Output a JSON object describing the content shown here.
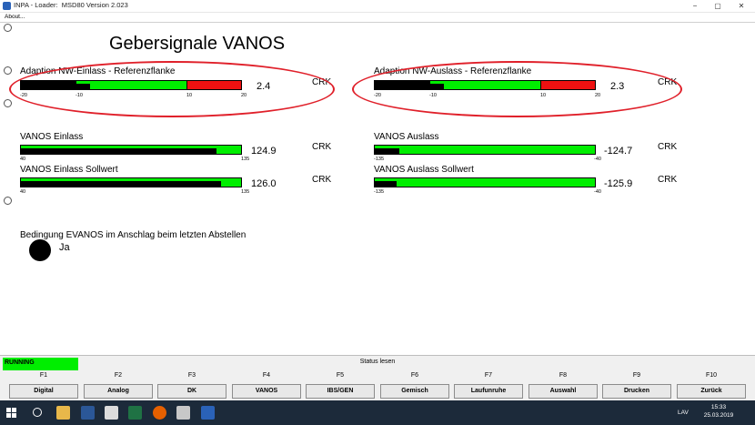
{
  "window": {
    "title": "INPA - Loader:  MSD80 Version 2.023",
    "menu_about": "About...",
    "minimize": "−",
    "maximize": "▢",
    "close": "✕"
  },
  "main": {
    "heading": "Gebersignale VANOS"
  },
  "adaption_einlass": {
    "label": "Adaption NW-Einlass - Referenzflanke",
    "value": "2.4",
    "unit": "CRK",
    "ticks": [
      "-20",
      "-10",
      "10",
      "20"
    ],
    "level": 2.4
  },
  "adaption_auslass": {
    "label": "Adaption NW-Auslass - Referenzflanke",
    "value": "2.3",
    "unit": "CRK",
    "ticks": [
      "-20",
      "-10",
      "10",
      "20"
    ],
    "level": 2.3
  },
  "vanos_einlass": {
    "label": "VANOS Einlass",
    "value": "124.9",
    "unit": "CRK",
    "tick_min": "40",
    "tick_max": "135",
    "level_fraction": 0.89
  },
  "vanos_einlass_soll": {
    "label": "VANOS Einlass Sollwert",
    "value": "126.0",
    "unit": "CRK",
    "tick_min": "40",
    "tick_max": "135",
    "level_fraction": 0.91
  },
  "vanos_auslass": {
    "label": "VANOS Auslass",
    "value": "-124.7",
    "unit": "CRK",
    "tick_min": "-135",
    "tick_max": "-40",
    "level_fraction": 0.11
  },
  "vanos_auslass_soll": {
    "label": "VANOS Auslass Sollwert",
    "value": "-125.9",
    "unit": "CRK",
    "tick_min": "-135",
    "tick_max": "-40",
    "level_fraction": 0.1
  },
  "bedingung": {
    "label": "Bedingung EVANOS im Anschlag beim letzten Abstellen",
    "value": "Ja"
  },
  "status": {
    "running": "RUNNING",
    "text": "Status lesen"
  },
  "fkeys": [
    {
      "key": "F1",
      "label": "Digital"
    },
    {
      "key": "F2",
      "label": "Analog"
    },
    {
      "key": "F3",
      "label": "DK"
    },
    {
      "key": "F4",
      "label": "VANOS"
    },
    {
      "key": "F5",
      "label": "IBS/GEN"
    },
    {
      "key": "F6",
      "label": "Gemisch"
    },
    {
      "key": "F7",
      "label": "Laufunruhe"
    },
    {
      "key": "F8",
      "label": "Auswahl"
    },
    {
      "key": "F9",
      "label": "Drucken"
    },
    {
      "key": "F10",
      "label": "Zurück"
    }
  ],
  "taskbar": {
    "lang": "LAV",
    "time": "15:33",
    "date": "25.03.2019"
  },
  "colors": {
    "bar_green": "#00ee00",
    "bar_red": "#ee1111",
    "ellipse_red": "#e0202a",
    "running_green": "#00ee00"
  }
}
